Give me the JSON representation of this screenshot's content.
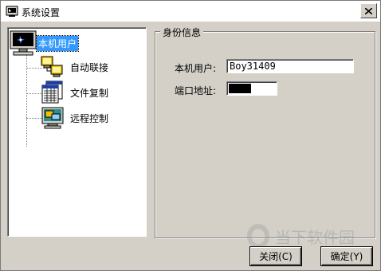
{
  "window": {
    "title": "系统设置",
    "close_symbol": "X"
  },
  "tree": {
    "root": {
      "label": "本机用户",
      "icon": "monitor-icon"
    },
    "children": [
      {
        "label": "自动联接",
        "icon": "network-computers-icon"
      },
      {
        "label": "文件复制",
        "icon": "file-copy-icon"
      },
      {
        "label": "远程控制",
        "icon": "remote-control-icon"
      }
    ]
  },
  "panel": {
    "group_title": "身份信息",
    "user_label": "本机用户:",
    "user_value": "Boy31409",
    "port_label": "端口地址:",
    "port_value": ""
  },
  "buttons": {
    "close_label": "关闭(C)",
    "ok_label": "确定(Y)"
  },
  "watermark": "当下软件园",
  "colors": {
    "selection": "#3399ff",
    "face": "#d4d0c8",
    "port_field": "#000000"
  }
}
